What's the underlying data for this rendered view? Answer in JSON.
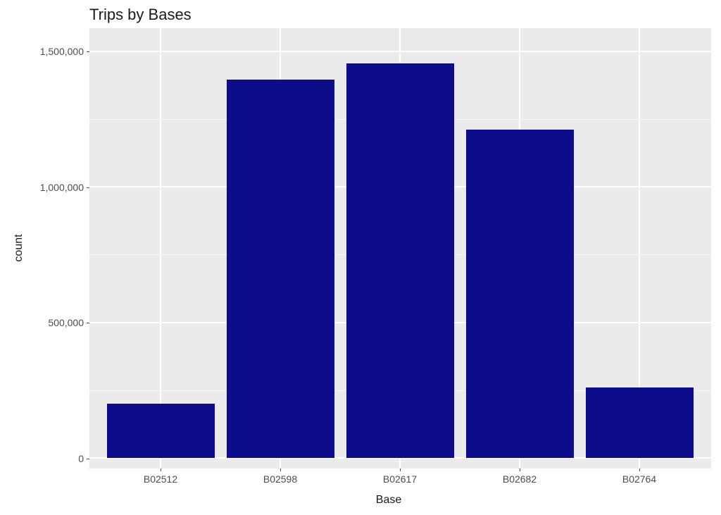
{
  "chart_data": {
    "type": "bar",
    "title": "Trips by Bases",
    "xlabel": "Base",
    "ylabel": "count",
    "categories": [
      "B02512",
      "B02598",
      "B02617",
      "B02682",
      "B02764"
    ],
    "values": [
      200000,
      1395000,
      1455000,
      1210000,
      260000
    ],
    "ylim": [
      0,
      1550000
    ],
    "yticks": [
      0,
      500000,
      1000000,
      1500000
    ],
    "ytick_labels": [
      "0",
      "500,000",
      "1,000,000",
      "1,500,000"
    ],
    "bar_color": "#0d0d8b",
    "panel_bg": "#ebebeb"
  }
}
